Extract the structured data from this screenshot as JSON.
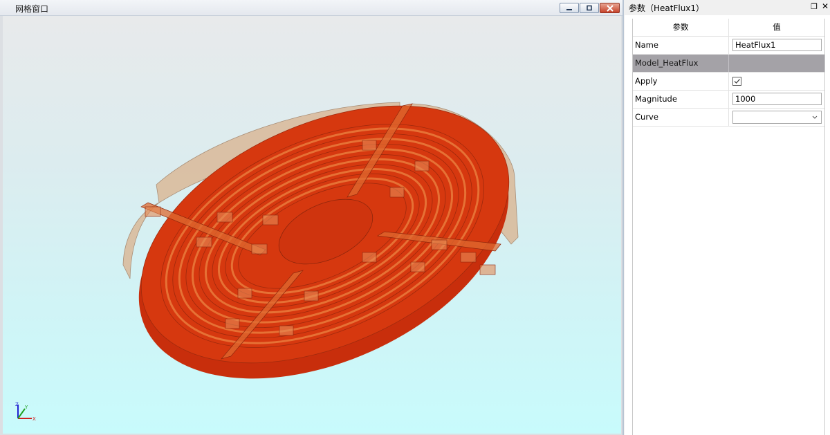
{
  "mesh_window": {
    "title": "网格窗口",
    "controls": {
      "minimize": "minimize-icon",
      "restore": "restore-icon",
      "close": "close-icon"
    },
    "model_colors": {
      "solid_face": "#d4350f",
      "transparent_body": "#d8b898",
      "background_top": "#e8eaeb",
      "background_bottom": "#c8fbfc"
    },
    "triad": {
      "x": "X",
      "y": "Y",
      "z": "Z"
    }
  },
  "properties": {
    "title": "参数（HeatFlux1）",
    "pin_icon": "pin-icon",
    "close_icon": "close-icon",
    "headers": {
      "key": "参数",
      "value": "值"
    },
    "rows": {
      "name": {
        "label": "Name",
        "value": "HeatFlux1"
      },
      "group": {
        "label": "Model_HeatFlux"
      },
      "apply": {
        "label": "Apply",
        "checked": true
      },
      "magnitude": {
        "label": "Magnitude",
        "value": "1000"
      },
      "curve": {
        "label": "Curve",
        "value": ""
      }
    }
  }
}
